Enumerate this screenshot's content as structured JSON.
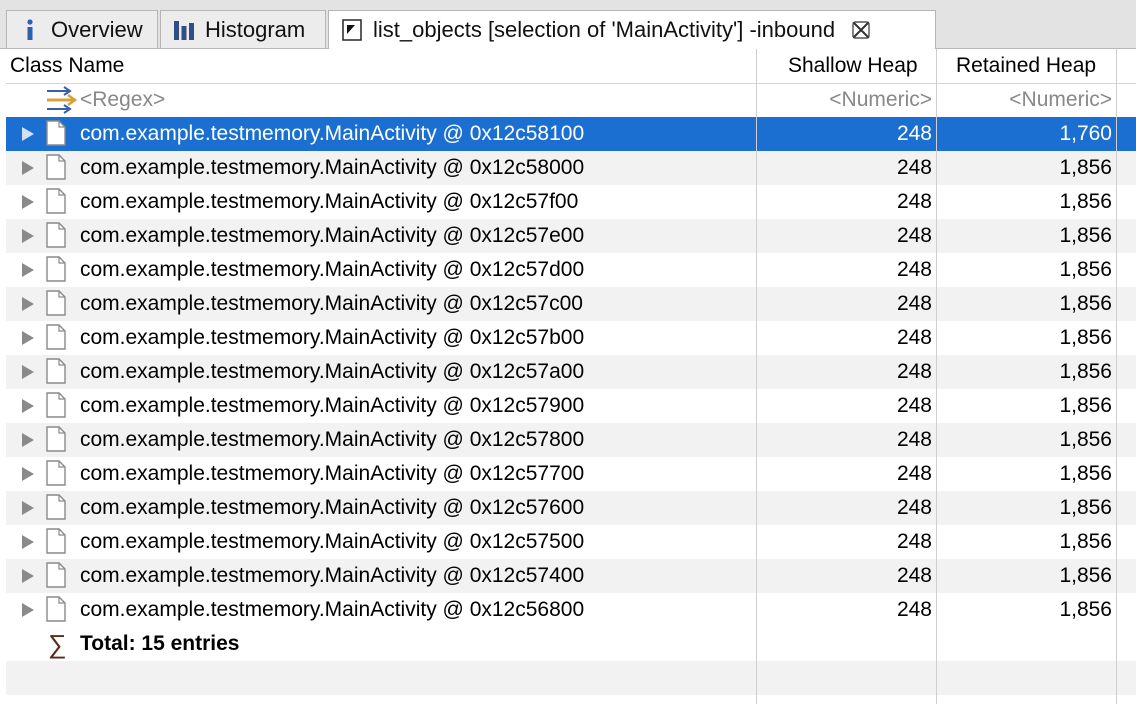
{
  "tabs": [
    {
      "label": "Overview",
      "icon": "info-icon"
    },
    {
      "label": "Histogram",
      "icon": "histogram-icon"
    },
    {
      "label": "list_objects [selection of 'MainActivity'] -inbound",
      "icon": "list-objects-icon",
      "active": true,
      "closable": true
    }
  ],
  "table": {
    "columns": [
      "Class Name",
      "Shallow Heap",
      "Retained Heap"
    ],
    "filter_row": {
      "name": "<Regex>",
      "shallow": "<Numeric>",
      "retained": "<Numeric>"
    },
    "rows": [
      {
        "name": "com.example.testmemory.MainActivity @ 0x12c58100",
        "shallow": "248",
        "retained": "1,760",
        "selected": true
      },
      {
        "name": "com.example.testmemory.MainActivity @ 0x12c58000",
        "shallow": "248",
        "retained": "1,856"
      },
      {
        "name": "com.example.testmemory.MainActivity @ 0x12c57f00",
        "shallow": "248",
        "retained": "1,856"
      },
      {
        "name": "com.example.testmemory.MainActivity @ 0x12c57e00",
        "shallow": "248",
        "retained": "1,856"
      },
      {
        "name": "com.example.testmemory.MainActivity @ 0x12c57d00",
        "shallow": "248",
        "retained": "1,856"
      },
      {
        "name": "com.example.testmemory.MainActivity @ 0x12c57c00",
        "shallow": "248",
        "retained": "1,856"
      },
      {
        "name": "com.example.testmemory.MainActivity @ 0x12c57b00",
        "shallow": "248",
        "retained": "1,856"
      },
      {
        "name": "com.example.testmemory.MainActivity @ 0x12c57a00",
        "shallow": "248",
        "retained": "1,856"
      },
      {
        "name": "com.example.testmemory.MainActivity @ 0x12c57900",
        "shallow": "248",
        "retained": "1,856"
      },
      {
        "name": "com.example.testmemory.MainActivity @ 0x12c57800",
        "shallow": "248",
        "retained": "1,856"
      },
      {
        "name": "com.example.testmemory.MainActivity @ 0x12c57700",
        "shallow": "248",
        "retained": "1,856"
      },
      {
        "name": "com.example.testmemory.MainActivity @ 0x12c57600",
        "shallow": "248",
        "retained": "1,856"
      },
      {
        "name": "com.example.testmemory.MainActivity @ 0x12c57500",
        "shallow": "248",
        "retained": "1,856"
      },
      {
        "name": "com.example.testmemory.MainActivity @ 0x12c57400",
        "shallow": "248",
        "retained": "1,856"
      },
      {
        "name": "com.example.testmemory.MainActivity @ 0x12c56800",
        "shallow": "248",
        "retained": "1,856"
      }
    ],
    "total_label": "Total: 15 entries"
  },
  "colors": {
    "selection": "#1b6fd0",
    "alt_row": "#f2f2f2"
  }
}
